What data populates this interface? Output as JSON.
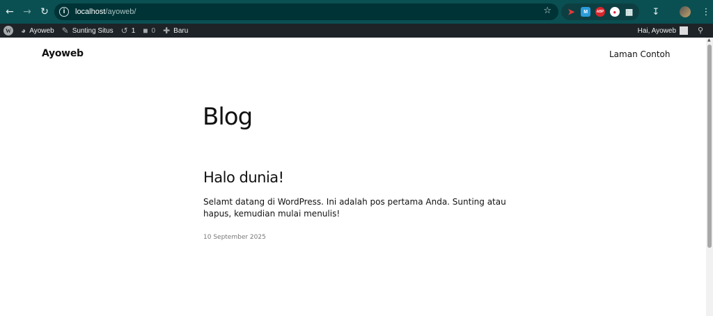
{
  "browser": {
    "url_host": "localhost",
    "url_path": "/ayoweb/",
    "icons": {
      "back": "back-arrow-icon",
      "forward": "forward-arrow-icon",
      "reload": "reload-icon",
      "info": "site-info-icon",
      "bookmark": "star-icon",
      "downloads": "download-icon",
      "menu": "kebab-menu-icon"
    },
    "extensions": {
      "abp_label": "ABP",
      "m_label": "M"
    }
  },
  "admin_bar": {
    "site_name": "Ayoweb",
    "customize": "Sunting Situs",
    "updates_count": "1",
    "comments_count": "0",
    "new_label": "Baru",
    "greeting": "Hai, Ayoweb"
  },
  "site": {
    "title": "Ayoweb",
    "nav_item": "Laman Contoh"
  },
  "main": {
    "heading": "Blog",
    "posts": [
      {
        "title": "Halo dunia!",
        "excerpt": "Selamt datang di WordPress. Ini adalah pos pertama Anda. Sunting atau hapus, kemudian mulai menulis!",
        "date": "10 September 2025"
      }
    ]
  }
}
